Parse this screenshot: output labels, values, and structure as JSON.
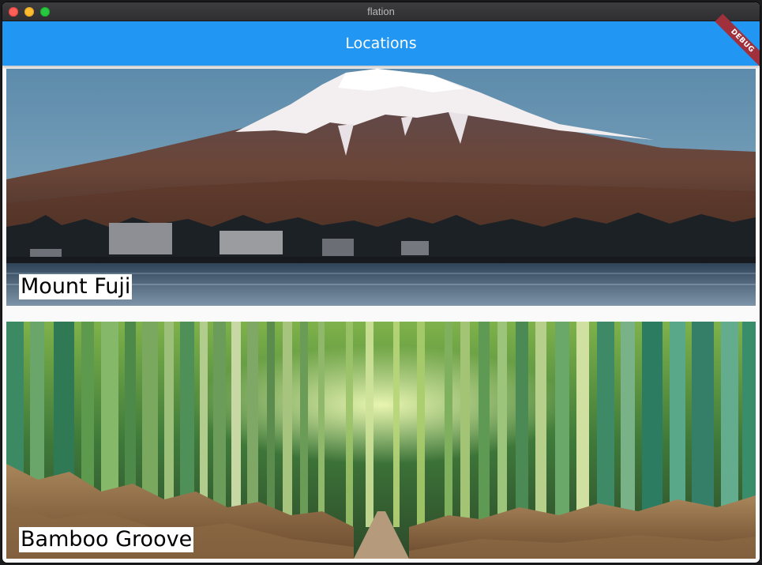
{
  "window": {
    "title": "flation",
    "traffic_lights": [
      "close",
      "minimize",
      "maximize"
    ]
  },
  "appbar": {
    "title": "Locations",
    "color": "#2196f3",
    "debug_banner": "DEBUG"
  },
  "locations": [
    {
      "name": "Mount Fuji",
      "image": "mountain-lake-image"
    },
    {
      "name": "Bamboo Groove",
      "image": "bamboo-forest-image"
    }
  ]
}
